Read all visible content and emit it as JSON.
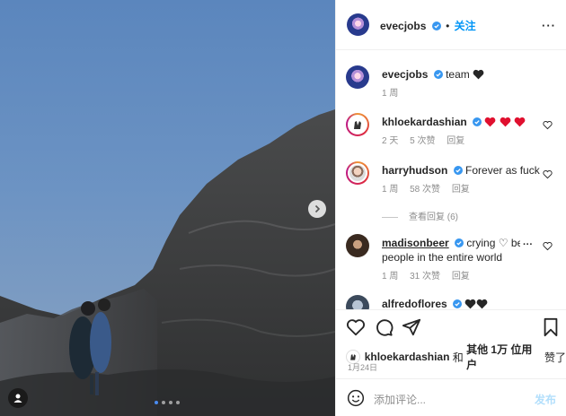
{
  "header": {
    "username": "evecjobs",
    "follow_label": "关注",
    "separator": "•"
  },
  "caption": {
    "username": "evecjobs",
    "text": "team",
    "time": "1 周"
  },
  "comments": [
    {
      "username": "khloekardashian",
      "text": "",
      "emoji": "red-hearts-x3",
      "time": "2 天",
      "likes": "5 次赞",
      "reply": "回复"
    },
    {
      "username": "harryhudson",
      "text": "Forever as fuck",
      "time": "1 周",
      "likes": "58 次赞",
      "reply": "回复"
    },
    {
      "username": "madisonbeer",
      "text": "crying ♡ best people in the entire world",
      "time": "1 周",
      "likes": "31 次赞",
      "reply": "回复"
    },
    {
      "username": "alfredoflores",
      "text": ""
    }
  ],
  "view_replies": "查看回复 (6)",
  "likes_line": {
    "user": "khloekardashian",
    "and": " 和 ",
    "others": "其他 1万 位用户",
    "suffix": " 赞了"
  },
  "date": "1月24日",
  "composer": {
    "placeholder": "添加评论...",
    "post_label": "发布"
  },
  "carousel": {
    "count": 4,
    "active_index": 0
  },
  "colors": {
    "accent": "#0095f6",
    "verified": "#3897f0",
    "heart_red": "#ed4956"
  }
}
